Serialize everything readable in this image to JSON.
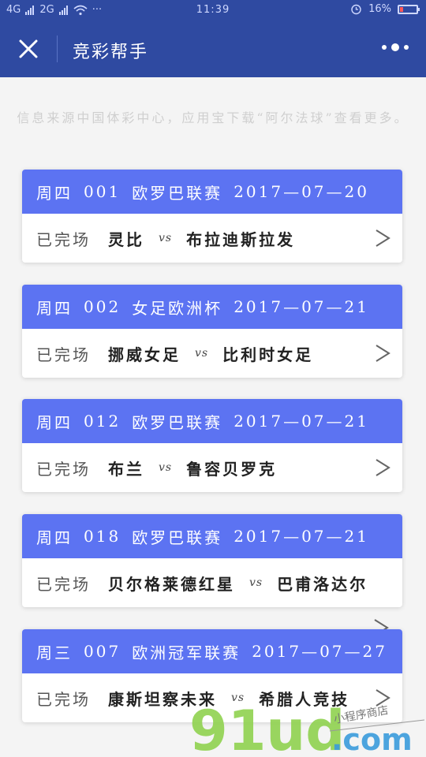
{
  "statusbar": {
    "signal_1": "4G",
    "signal_2": "2G",
    "more": "···",
    "time": "11:39",
    "battery_percent": "16%",
    "battery_level": 0.16
  },
  "navbar": {
    "title": "竞彩帮手"
  },
  "notice": "信息来源中国体彩中心，应用宝下载“阿尔法球”查看更多。",
  "matches": [
    {
      "day": "周四",
      "number": "001",
      "league": "欧罗巴联赛",
      "date": "2017—07—20",
      "status": "已完场",
      "home": "灵比",
      "vs": "vs",
      "away": "布拉迪斯拉发"
    },
    {
      "day": "周四",
      "number": "002",
      "league": "女足欧洲杯",
      "date": "2017—07—21",
      "status": "已完场",
      "home": "挪威女足",
      "vs": "vs",
      "away": "比利时女足"
    },
    {
      "day": "周四",
      "number": "012",
      "league": "欧罗巴联赛",
      "date": "2017—07—21",
      "status": "已完场",
      "home": "布兰",
      "vs": "vs",
      "away": "鲁容贝罗克"
    },
    {
      "day": "周四",
      "number": "018",
      "league": "欧罗巴联赛",
      "date": "2017—07—21",
      "status": "已完场",
      "home": "贝尔格莱德红星",
      "vs": "vs",
      "away": "巴甫洛达尔"
    },
    {
      "day": "周三",
      "number": "007",
      "league": "欧洲冠军联赛",
      "date": "2017—07—27",
      "status": "已完场",
      "home": "康斯坦察未来",
      "vs": "vs",
      "away": "希腊人竞技"
    }
  ],
  "watermark": {
    "brand": "91ud",
    "domain": ".com",
    "tagline": "小程序商店"
  },
  "colors": {
    "navbar": "#2f4aa1",
    "card_header": "#5c73f2",
    "watermark_green": "#8fd14f",
    "watermark_blue": "#3a9bdc"
  }
}
